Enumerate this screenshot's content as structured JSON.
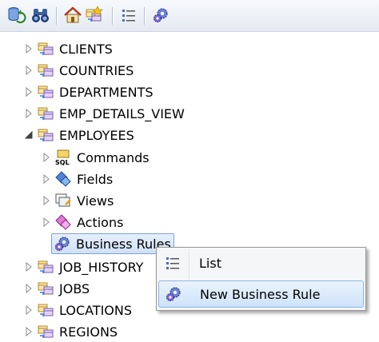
{
  "toolbar": {
    "buttons": [
      {
        "icon": "database-refresh-icon"
      },
      {
        "icon": "binoculars-icon"
      },
      {
        "icon": "home-icon"
      },
      {
        "icon": "connect-settings-icon"
      },
      {
        "icon": "list-icon"
      },
      {
        "icon": "gear-icon"
      }
    ]
  },
  "tree": {
    "nodes": [
      {
        "label": "CLIENTS",
        "icon": "table-icon",
        "expanded": false
      },
      {
        "label": "COUNTRIES",
        "icon": "table-icon",
        "expanded": false
      },
      {
        "label": "DEPARTMENTS",
        "icon": "table-icon",
        "expanded": false
      },
      {
        "label": "EMP_DETAILS_VIEW",
        "icon": "table-icon",
        "expanded": false
      },
      {
        "label": "EMPLOYEES",
        "icon": "table-icon",
        "expanded": true,
        "children": [
          {
            "label": "Commands",
            "icon": "sql-icon"
          },
          {
            "label": "Fields",
            "icon": "fields-icon"
          },
          {
            "label": "Views",
            "icon": "views-icon"
          },
          {
            "label": "Actions",
            "icon": "actions-icon"
          },
          {
            "label": "Business Rules",
            "icon": "gear-icon",
            "highlighted": true
          }
        ]
      },
      {
        "label": "JOB_HISTORY",
        "icon": "table-icon",
        "expanded": false
      },
      {
        "label": "JOBS",
        "icon": "table-icon",
        "expanded": false
      },
      {
        "label": "LOCATIONS",
        "icon": "table-icon",
        "expanded": false
      },
      {
        "label": "REGIONS",
        "icon": "table-icon",
        "expanded": false
      }
    ]
  },
  "context_menu": {
    "items": [
      {
        "label": "List",
        "icon": "list-icon",
        "selected": false
      },
      {
        "label": "New Business Rule",
        "icon": "gear-icon",
        "selected": true
      }
    ]
  },
  "colors": {
    "highlight_border": "#7da2ce",
    "selection_fill": "#cfe3fa"
  }
}
